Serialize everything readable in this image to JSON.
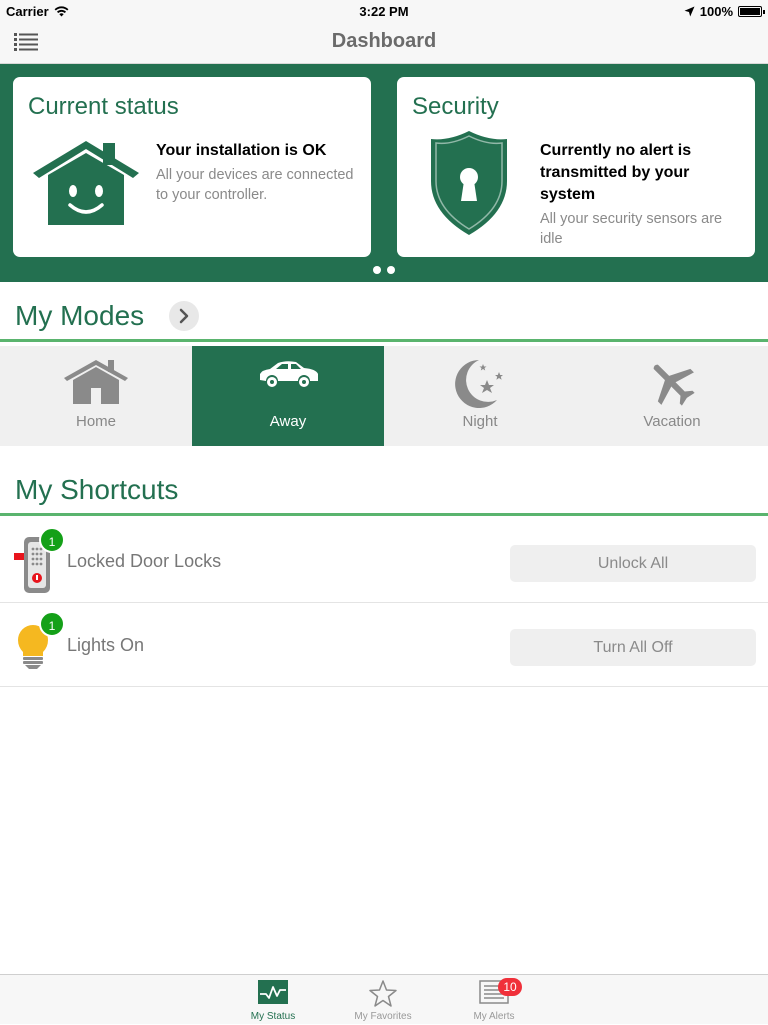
{
  "status_bar": {
    "carrier": "Carrier",
    "time": "3:22 PM",
    "battery": "100%"
  },
  "navbar": {
    "title": "Dashboard"
  },
  "cards": [
    {
      "title": "Current status",
      "headline": "Your installation is OK",
      "description": "All your devices are connected to your controller.",
      "icon": "house-smile-icon"
    },
    {
      "title": "Security",
      "headline": "Currently no alert is transmitted by your system",
      "description": "All your security sensors are idle",
      "icon": "shield-keyhole-icon"
    }
  ],
  "carousel": {
    "page_count": 2
  },
  "modes_section": {
    "title": "My Modes",
    "items": [
      {
        "label": "Home",
        "icon": "house-icon",
        "active": false
      },
      {
        "label": "Away",
        "icon": "car-icon",
        "active": true
      },
      {
        "label": "Night",
        "icon": "moon-stars-icon",
        "active": false
      },
      {
        "label": "Vacation",
        "icon": "airplane-icon",
        "active": false
      }
    ]
  },
  "shortcuts_section": {
    "title": "My Shortcuts",
    "items": [
      {
        "label": "Locked Door Locks",
        "badge": "1",
        "action": "Unlock All",
        "icon": "door-lock-icon"
      },
      {
        "label": "Lights On",
        "badge": "1",
        "action": "Turn All Off",
        "icon": "light-bulb-icon"
      }
    ]
  },
  "tabbar": {
    "tabs": [
      {
        "label": "My Status",
        "icon": "status-chart-icon",
        "active": true
      },
      {
        "label": "My Favorites",
        "icon": "star-icon",
        "active": false
      },
      {
        "label": "My Alerts",
        "icon": "alerts-list-icon",
        "active": false,
        "badge": "10"
      }
    ]
  },
  "colors": {
    "brand_green": "#237050",
    "accent_green": "#5ab46e",
    "badge_green": "#14a018",
    "badge_red": "#f0303a",
    "bulb_yellow": "#f5b820"
  }
}
